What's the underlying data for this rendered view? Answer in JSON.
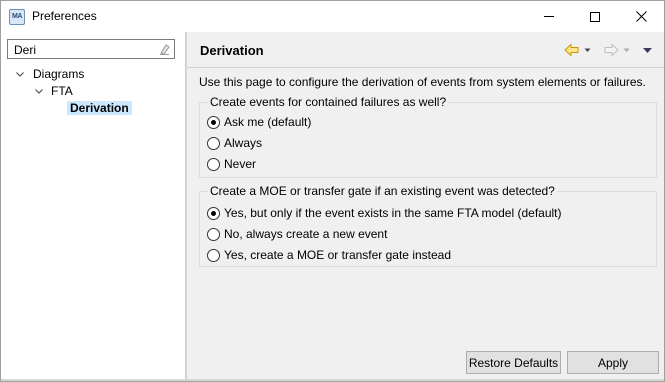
{
  "window": {
    "title": "Preferences",
    "app_icon_text": "MA"
  },
  "filter": {
    "value": "Deri"
  },
  "tree": [
    {
      "label": "Diagrams",
      "expanded": true,
      "level": 0
    },
    {
      "label": "FTA",
      "expanded": true,
      "level": 1
    },
    {
      "label": "Derivation",
      "selected": true,
      "level": 2
    }
  ],
  "page": {
    "title": "Derivation",
    "description": "Use this page to configure the derivation of events from system elements or failures."
  },
  "group1": {
    "label": "Create events for contained failures as well?",
    "options": [
      {
        "label": "Ask me (default)",
        "checked": true
      },
      {
        "label": "Always",
        "checked": false
      },
      {
        "label": "Never",
        "checked": false
      }
    ]
  },
  "group2": {
    "label": "Create a MOE or transfer gate if an existing event was detected?",
    "options": [
      {
        "label": "Yes, but only if the event exists in the same FTA model (default)",
        "checked": true
      },
      {
        "label": "No, always create a new event",
        "checked": false
      },
      {
        "label": "Yes, create a MOE or transfer gate instead",
        "checked": false
      }
    ]
  },
  "buttons": {
    "restore_defaults": "Restore Defaults",
    "apply": "Apply"
  },
  "colors": {
    "selection": "#cce8ff",
    "back_arrow": "#e8b400",
    "forward_arrow_disabled": "#bdbdbd"
  }
}
